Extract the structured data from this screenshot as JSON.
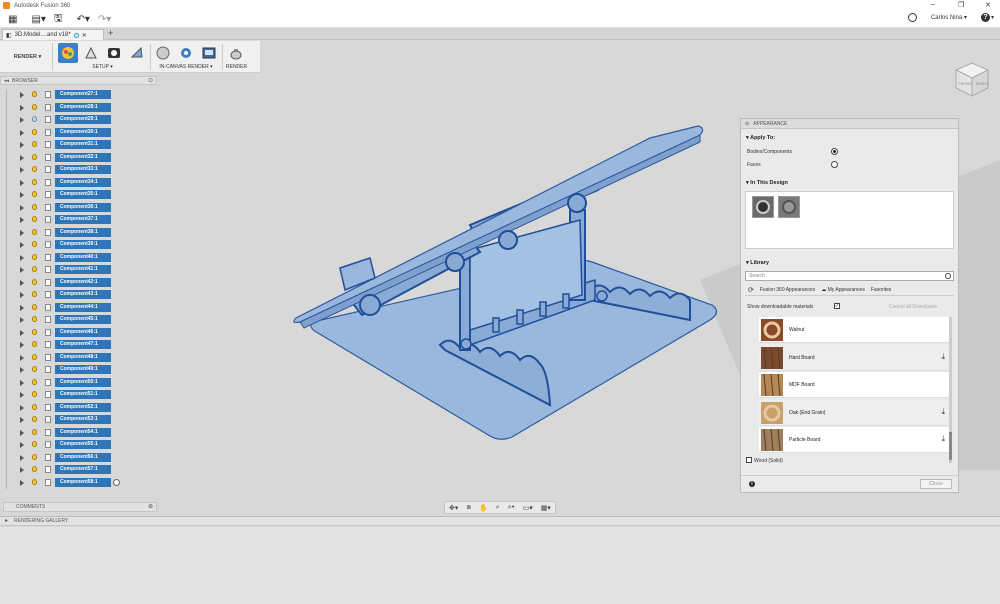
{
  "window": {
    "title": "Autodesk Fusion 360"
  },
  "user": {
    "name": "Carlos Nina"
  },
  "document_tab": {
    "label": "3D.Model....and v18*"
  },
  "workspace": {
    "label": "RENDER"
  },
  "ribbon": {
    "setup_label": "SETUP",
    "in_canvas_label": "IN-CANVAS RENDER",
    "render_label": "RENDER"
  },
  "browser": {
    "title": "BROWSER",
    "components": [
      "Component27:1",
      "Component28:1",
      "Component29:1",
      "Component30:1",
      "Component31:1",
      "Component32:1",
      "Component33:1",
      "Component34:1",
      "Component35:1",
      "Component36:1",
      "Component37:1",
      "Component38:1",
      "Component39:1",
      "Component40:1",
      "Component41:1",
      "Component42:1",
      "Component43:1",
      "Component44:1",
      "Component45:1",
      "Component46:1",
      "Component47:1",
      "Component48:1",
      "Component49:1",
      "Component50:1",
      "Component51:1",
      "Component52:1",
      "Component53:1",
      "Component54:1",
      "Component55:1",
      "Component56:1",
      "Component57:1",
      "Component58:1"
    ]
  },
  "appearance": {
    "title": "APPEARANCE",
    "apply_to": "Apply To:",
    "bodies_components": "Bodies/Components",
    "faces": "Faces",
    "in_this_design": "In This Design",
    "library": "Library",
    "search_placeholder": "Search",
    "tab_fusion": "Fusion 360 Appearances",
    "tab_my": "My Appearances",
    "tab_favorites": "Favorites",
    "show_downloadable": "Show downloadable materials",
    "cancel_downloads": "Cancel all Downloads",
    "materials": [
      {
        "name": "Walnut",
        "downloadable": false
      },
      {
        "name": "Hard Board",
        "downloadable": true
      },
      {
        "name": "MDF Board",
        "downloadable": false
      },
      {
        "name": "Oak (End Grain)",
        "downloadable": true
      },
      {
        "name": "Particle Board",
        "downloadable": true
      }
    ],
    "wood_solid": "Wood (Solid)",
    "close_label": "Close"
  },
  "comments": {
    "title": "COMMENTS"
  },
  "rendering_gallery": {
    "title": "RENDERING GALLERY"
  },
  "viewcube": {
    "front": "FRONT",
    "right": "RIGHT"
  },
  "colors": {
    "accent": "#2f76b8",
    "model_fill": "#9ab8dd",
    "model_edge": "#1f4f99"
  }
}
